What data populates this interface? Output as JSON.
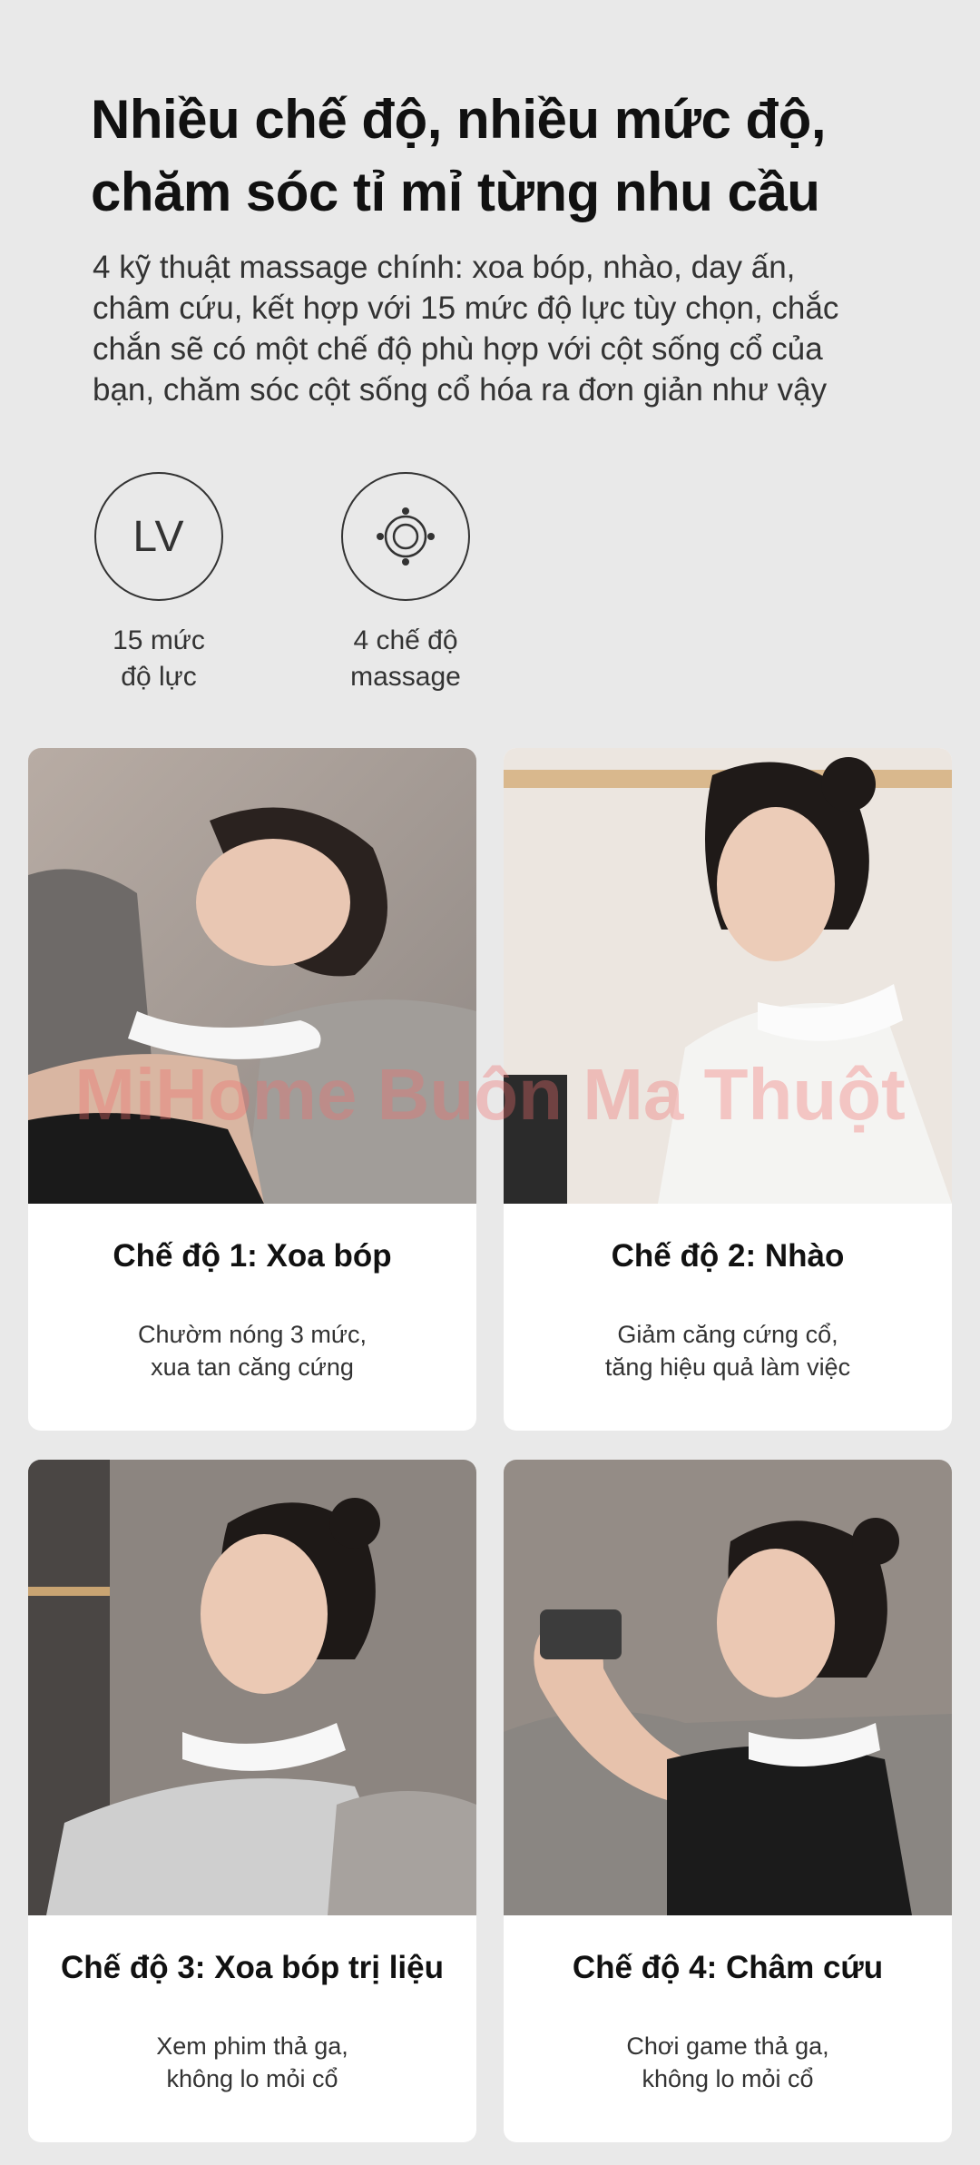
{
  "headline": {
    "line1": "Nhiều chế độ, nhiều mức độ,",
    "line2": "chăm sóc tỉ mỉ từng nhu cầu"
  },
  "subtitle": {
    "line1": "4 kỹ thuật massage chính: xoa bóp, nhào, day ấn,",
    "line2": "châm cứu, kết hợp với 15 mức độ lực tùy chọn, chắc",
    "line3": "chắn sẽ có một chế độ phù hợp với cột sống cổ của",
    "line4": "bạn, chăm sóc cột sống cổ hóa ra đơn giản như vậy"
  },
  "features": [
    {
      "icon_text": "LV",
      "icon": "level-icon",
      "line1": "15 mức",
      "line2": "độ lực"
    },
    {
      "icon": "massage-modes-icon",
      "line1": "4 chế độ",
      "line2": "massage"
    }
  ],
  "cards": [
    {
      "title": "Chế độ 1: Xoa bóp",
      "desc1": "Chườm nóng 3 mức,",
      "desc2": "xua tan căng cứng",
      "image": "woman-reclining-on-sofa-with-neck-massager-photo"
    },
    {
      "title": "Chế độ 2: Nhào",
      "desc1": "Giảm căng cứng cổ,",
      "desc2": "tăng hiệu quả làm việc",
      "image": "woman-working-at-laptop-with-neck-massager-photo"
    },
    {
      "title": "Chế độ 3: Xoa bóp trị liệu",
      "desc1": "Xem phim thả ga,",
      "desc2": "không lo mỏi cổ",
      "image": "woman-smiling-adjusting-neck-massager-photo"
    },
    {
      "title": "Chế độ 4: Châm cứu",
      "desc1": "Chơi game thả ga,",
      "desc2": "không lo mỏi cổ",
      "image": "woman-playing-phone-game-with-neck-massager-photo"
    }
  ],
  "watermark": "MiHome Buôn Ma Thuột",
  "colors": {
    "background": "#e9e9e9",
    "card": "#ffffff",
    "text": "#111111",
    "watermark": "#f06e6e"
  }
}
